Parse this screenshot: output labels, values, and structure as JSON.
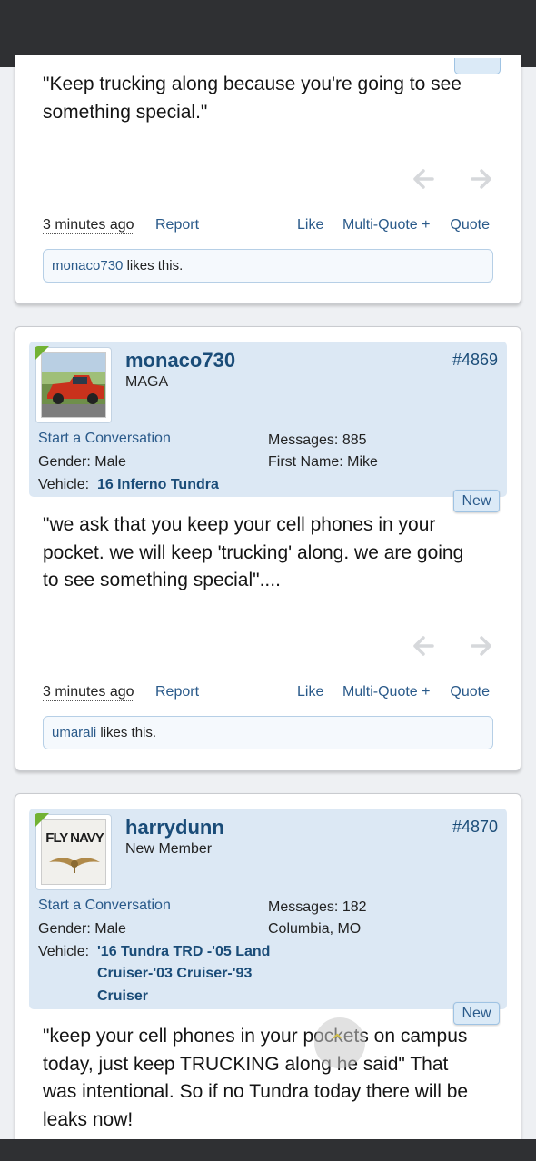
{
  "posts": [
    {
      "message": "\"Keep trucking along because you're going to see something special.\"",
      "footer": {
        "time": "3 minutes ago",
        "report": "Report",
        "like": "Like",
        "multiquote": "Multi-Quote +",
        "quote": "Quote"
      },
      "likes": {
        "user": "monaco730",
        "suffix": " likes this."
      }
    },
    {
      "user": {
        "name": "monaco730",
        "title": "MAGA",
        "post_number": "#4869"
      },
      "start_conversation": "Start a Conversation",
      "fields": {
        "messages_label": "Messages:",
        "messages_value": "885",
        "gender_label": "Gender:",
        "gender_value": "Male",
        "firstname_label": "First Name:",
        "firstname_value": "Mike",
        "vehicle_label": "Vehicle:",
        "vehicle_value": "16 Inferno Tundra"
      },
      "new_label": "New",
      "message": "\"we ask that you keep your cell phones in your pocket. we will keep 'trucking' along. we are going to see something special\"....",
      "footer": {
        "time": "3 minutes ago",
        "report": "Report",
        "like": "Like",
        "multiquote": "Multi-Quote +",
        "quote": "Quote"
      },
      "likes": {
        "user": "umarali",
        "suffix": " likes this."
      }
    },
    {
      "user": {
        "name": "harrydunn",
        "title": "New Member",
        "post_number": "#4870",
        "avatar_text": "FLY NAVY"
      },
      "start_conversation": "Start a Conversation",
      "fields": {
        "messages_label": "Messages:",
        "messages_value": "182",
        "location": "Columbia, MO",
        "gender_label": "Gender:",
        "gender_value": "Male",
        "vehicle_label": "Vehicle:",
        "vehicle_line1": "'16 Tundra TRD -'05 Land",
        "vehicle_line2": "Cruiser-'03 Cruiser-'93",
        "vehicle_line3": "Cruiser"
      },
      "new_label": "New",
      "message": "\"keep your cell phones in your pockets on campus today, just keep TRUCKING along he said\" That was intentional. So if no Tundra today there will be leaks now!"
    }
  ],
  "icons": {
    "prev": "arrow-left-icon",
    "next": "arrow-right-icon",
    "scroll": "scroll-up-icon"
  },
  "colors": {
    "accent": "#1a4c78",
    "link": "#2a5a8a",
    "userblock": "#dce8f4",
    "online": "#72b234"
  }
}
